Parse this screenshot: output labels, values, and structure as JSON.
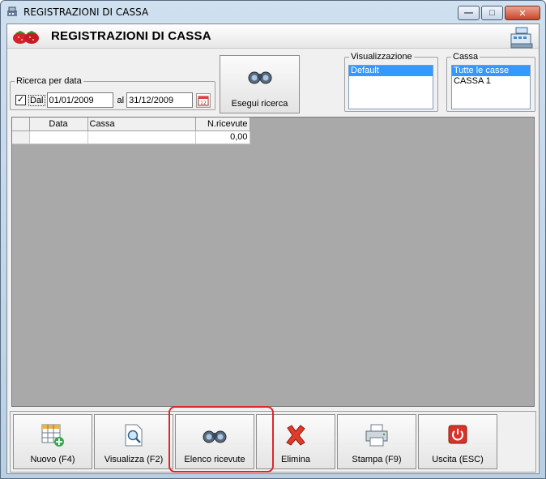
{
  "window": {
    "title": "REGISTRAZIONI DI CASSA",
    "controls": {
      "minimize": "—",
      "maximize": "□",
      "close": "✕"
    }
  },
  "header": {
    "title": "REGISTRAZIONI DI CASSA"
  },
  "date_search": {
    "legend": "Ricerca per data",
    "checkbox_checked": true,
    "from_label": "Dal",
    "from_value": "01/01/2009",
    "to_label": "al",
    "to_value": "31/12/2009",
    "calendar_glyph": "12"
  },
  "search_button": {
    "label": "Esegui ricerca"
  },
  "visualizzazione": {
    "legend": "Visualizzazione",
    "items": [
      {
        "label": "Default",
        "selected": true
      }
    ]
  },
  "cassa": {
    "legend": "Cassa",
    "items": [
      {
        "label": "Tutte le casse",
        "selected": true
      },
      {
        "label": "CASSA 1",
        "selected": false
      }
    ]
  },
  "grid": {
    "columns": [
      "",
      "Data",
      "Cassa",
      "N.ricevute"
    ],
    "rows": [
      {
        "data": "",
        "cassa": "",
        "n_ricevute": "0,00"
      }
    ]
  },
  "toolbar": {
    "buttons": [
      {
        "label": "Nuovo (F4)",
        "icon": "grid-add-icon"
      },
      {
        "label": "Visualizza (F2)",
        "icon": "document-search-icon"
      },
      {
        "label": "Elenco ricevute",
        "icon": "binoculars-icon",
        "highlighted": true
      },
      {
        "label": "Elimina",
        "icon": "red-x-icon"
      },
      {
        "label": "Stampa (F9)",
        "icon": "printer-icon"
      },
      {
        "label": "Uscita (ESC)",
        "icon": "power-icon"
      }
    ]
  },
  "colors": {
    "highlight": "#e0262a",
    "selection": "#3399ff",
    "grid_background": "#a9a9a9"
  }
}
